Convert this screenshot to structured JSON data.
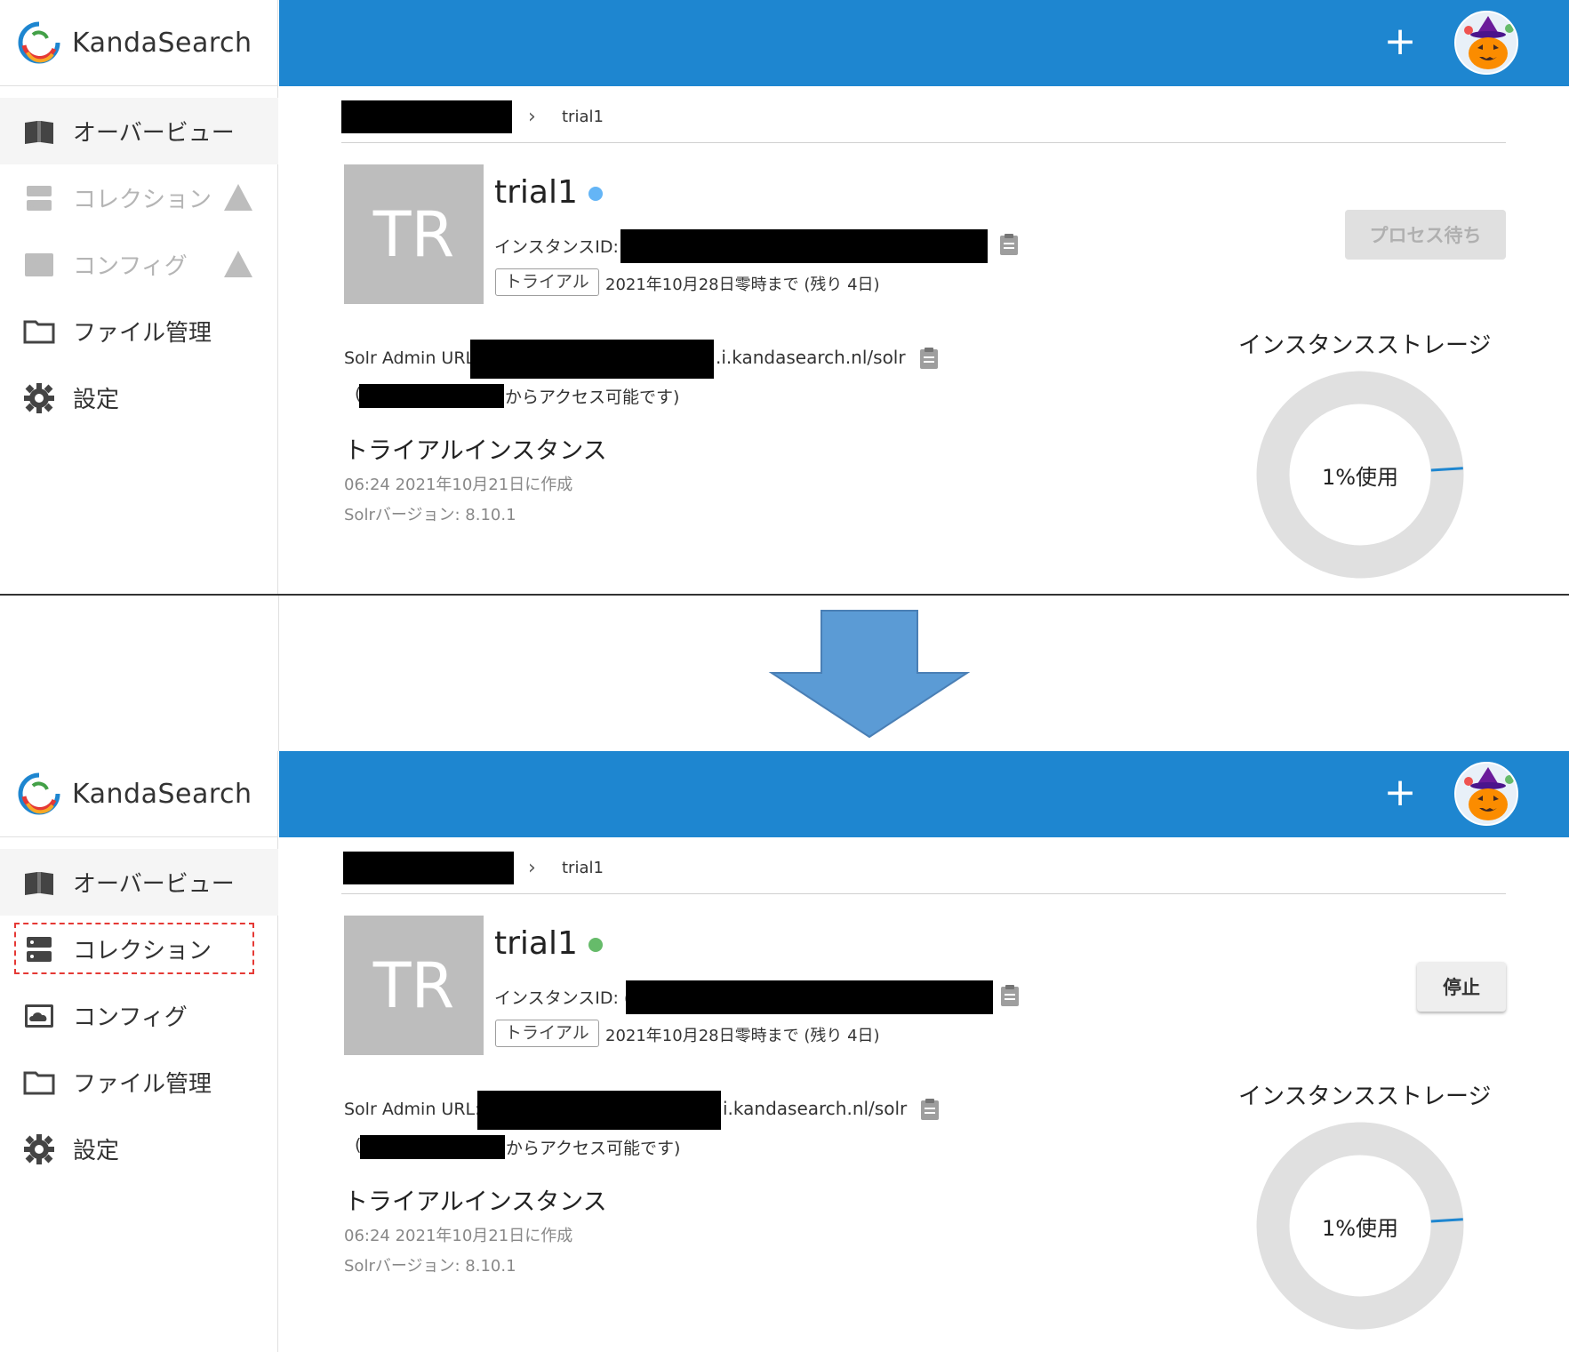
{
  "app": {
    "brand": "KandaSearch",
    "add_label": "+"
  },
  "sidebar": {
    "items": [
      {
        "label": "オーバービュー",
        "icon": "book-icon"
      },
      {
        "label": "コレクション",
        "icon": "database-icon"
      },
      {
        "label": "コンフィグ",
        "icon": "cloud-config-icon"
      },
      {
        "label": "ファイル管理",
        "icon": "folder-icon"
      },
      {
        "label": "設定",
        "icon": "gear-icon"
      }
    ]
  },
  "before": {
    "breadcrumb_current": "trial1",
    "tile": "TR",
    "instance_name": "trial1",
    "instance_id_label": "インスタンスID:",
    "tag": "トライアル",
    "expiry": "2021年10月28日零時まで (残り 4日)",
    "action_button": "プロセス待ち",
    "url_label": "Solr Admin URL:",
    "url_suffix": ".i.kandasearch.nl/solr",
    "access_paren": "(",
    "access_note": "からアクセス可能です)",
    "trial_title": "トライアルインスタンス",
    "created": "06:24 2021年10月21日に作成",
    "solr_version": "Solrバージョン: 8.10.1",
    "storage_title": "インスタンスストレージ",
    "storage_label": "1%使用",
    "storage_used_pct": 1,
    "status_color": "#64b5f6"
  },
  "after": {
    "breadcrumb_current": "trial1",
    "tile": "TR",
    "instance_name": "trial1",
    "instance_id_label": "インスタンスID: (",
    "tag": "トライアル",
    "expiry": "2021年10月28日零時まで (残り 4日)",
    "action_button": "停止",
    "url_label": "Solr Admin URL:",
    "url_suffix": "i.kandasearch.nl/solr",
    "access_paren": "(",
    "access_note": "からアクセス可能です)",
    "trial_title": "トライアルインスタンス",
    "created": "06:24 2021年10月21日に作成",
    "solr_version": "Solrバージョン: 8.10.1",
    "storage_title": "インスタンスストレージ",
    "storage_label": "1%使用",
    "storage_used_pct": 1,
    "status_color": "#66bb6a"
  },
  "colors": {
    "topbar": "#1e86d0",
    "warning": "#f9a825",
    "highlight": "#e53935",
    "arrow": "#5b9bd5"
  }
}
